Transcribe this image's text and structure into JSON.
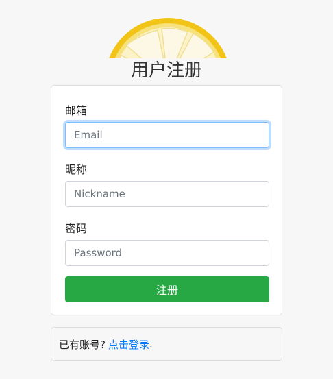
{
  "page": {
    "title": "用户注册"
  },
  "form": {
    "email": {
      "label": "邮箱",
      "placeholder": "Email",
      "value": ""
    },
    "nickname": {
      "label": "昵称",
      "placeholder": "Nickname",
      "value": ""
    },
    "password": {
      "label": "密码",
      "placeholder": "Password",
      "value": ""
    },
    "submit_label": "注册"
  },
  "footer": {
    "prompt": "已有账号?",
    "login_link": "点击登录",
    "suffix": "."
  },
  "colors": {
    "accent_green": "#28a745",
    "link_blue": "#007bff",
    "focus_border": "#80bdff",
    "background": "#f7f7f7"
  },
  "icons": {
    "logo": "lemon-slice-logo"
  }
}
